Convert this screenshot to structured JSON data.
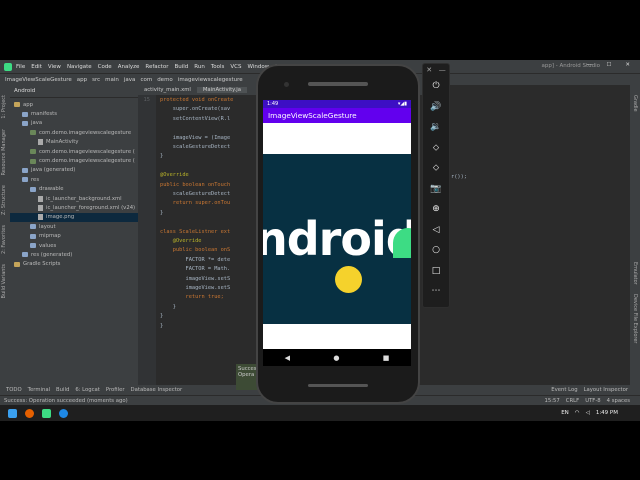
{
  "menu": {
    "items": [
      "File",
      "Edit",
      "View",
      "Navigate",
      "Code",
      "Analyze",
      "Refactor",
      "Build",
      "Run",
      "Tools",
      "VCS",
      "Window",
      "H"
    ],
    "window_title": "app] - Android Studio",
    "win_controls": [
      "—",
      "☐",
      "✕"
    ]
  },
  "breadcrumb": [
    "ImageViewScaleGesture",
    "app",
    "src",
    "main",
    "java",
    "com",
    "demo",
    "imageviewscalegesture"
  ],
  "left_tools": [
    "1: Project",
    "Resource Manager",
    "Z: Structure",
    "2: Favorites",
    "Build Variants"
  ],
  "project": {
    "header": "Android",
    "tree": [
      {
        "label": "app",
        "indent": 0,
        "kind": "folder"
      },
      {
        "label": "manifests",
        "indent": 1,
        "kind": "folder"
      },
      {
        "label": "java",
        "indent": 1,
        "kind": "folder"
      },
      {
        "label": "com.demo.imageviewscalegesture",
        "indent": 2,
        "kind": "pkg"
      },
      {
        "label": "MainActivity",
        "indent": 3,
        "kind": "file"
      },
      {
        "label": "com.demo.imageviewscalegesture (",
        "indent": 2,
        "kind": "pkg"
      },
      {
        "label": "com.demo.imageviewscalegesture (",
        "indent": 2,
        "kind": "pkg"
      },
      {
        "label": "java (generated)",
        "indent": 1,
        "kind": "folder"
      },
      {
        "label": "res",
        "indent": 1,
        "kind": "folder"
      },
      {
        "label": "drawable",
        "indent": 2,
        "kind": "folder"
      },
      {
        "label": "ic_launcher_background.xml",
        "indent": 3,
        "kind": "file"
      },
      {
        "label": "ic_launcher_foreground.xml (v24)",
        "indent": 3,
        "kind": "file"
      },
      {
        "label": "image.png",
        "indent": 3,
        "kind": "file",
        "selected": true
      },
      {
        "label": "layout",
        "indent": 2,
        "kind": "folder"
      },
      {
        "label": "mipmap",
        "indent": 2,
        "kind": "folder"
      },
      {
        "label": "values",
        "indent": 2,
        "kind": "folder"
      },
      {
        "label": "res (generated)",
        "indent": 1,
        "kind": "folder"
      },
      {
        "label": "Gradle Scripts",
        "indent": 0,
        "kind": "folder"
      }
    ]
  },
  "editor": {
    "tabs": [
      "activity_main.xml",
      "MainActivity.ja"
    ],
    "lines": [
      {
        "n": "15",
        "text": "protected void onCreate"
      },
      {
        "n": "",
        "text": "    super.onCreate(sav"
      },
      {
        "n": "",
        "text": "    setContentView(R.l"
      },
      {
        "n": "",
        "text": ""
      },
      {
        "n": "",
        "text": "    imageView = (Image"
      },
      {
        "n": "",
        "text": "    scaleGestureDetect"
      },
      {
        "n": "",
        "text": "}"
      },
      {
        "n": "",
        "text": ""
      },
      {
        "n": "",
        "text": "@Override"
      },
      {
        "n": "",
        "text": "public boolean onTouch"
      },
      {
        "n": "",
        "text": "    scaleGestureDetect"
      },
      {
        "n": "",
        "text": "    return super.onTou"
      },
      {
        "n": "",
        "text": "}"
      },
      {
        "n": "",
        "text": ""
      },
      {
        "n": "",
        "text": "class ScaleListner ext"
      },
      {
        "n": "",
        "text": "    @Override"
      },
      {
        "n": "",
        "text": "    public boolean onS"
      },
      {
        "n": "",
        "text": "        FACTOR *= dete"
      },
      {
        "n": "",
        "text": "        FACTOR = Math."
      },
      {
        "n": "",
        "text": "        imageView.setS"
      },
      {
        "n": "",
        "text": "        imageView.setS"
      },
      {
        "n": "",
        "text": "        return true;"
      },
      {
        "n": "",
        "text": "    }"
      },
      {
        "n": "",
        "text": "}"
      },
      {
        "n": "",
        "text": "}"
      }
    ],
    "right_snippet": "r());"
  },
  "right_tools": [
    "Gradle",
    "Emulator",
    "Device File Explorer"
  ],
  "bottom_tools": [
    "TODO",
    "Terminal",
    "Build",
    "6: Logcat",
    "Profiler",
    "Database Inspector"
  ],
  "bottom_tools_right": [
    "Event Log",
    "Layout Inspector"
  ],
  "status": {
    "message": "Success: Operation succeeded (moments ago)",
    "pos": "15:57",
    "crlf": "CRLF",
    "enc": "UTF-8",
    "indent": "4 spaces"
  },
  "toast": {
    "line1": "Succes",
    "line2": "Opera"
  },
  "taskbar": {
    "lang": "EN",
    "time": "1:49 PM"
  },
  "phone": {
    "status_time": "1:49",
    "app_title": "ImageViewScaleGesture",
    "image_text": "ndroid",
    "nav": [
      "◀",
      "●",
      "■"
    ]
  },
  "emulator_controls": {
    "top": [
      "✕",
      "—"
    ],
    "buttons": [
      "⏻",
      "🔊",
      "🔉",
      "⬦",
      "⬦",
      "📷",
      "⊕",
      "◁",
      "○",
      "□",
      "⋯"
    ]
  },
  "colors": {
    "appbar": "#6200ee",
    "statusbar": "#3d0fc4",
    "image_bg": "#073042",
    "droid": "#3ddc84",
    "dot": "#f5d22c"
  }
}
